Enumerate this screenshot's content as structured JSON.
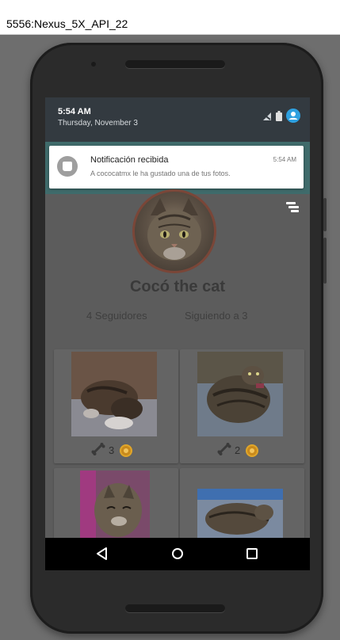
{
  "window": {
    "title": "5556:Nexus_5X_API_22"
  },
  "statusbar": {
    "time": "5:54 AM",
    "date": "Thursday, November 3"
  },
  "notification": {
    "title": "Notificación recibida",
    "text": "A cococatmx le ha gustado una de tus fotos.",
    "time": "5:54 AM"
  },
  "profile": {
    "name": "Cocó the cat",
    "followers": "4 Seguidores",
    "following": "Siguiendo a  3"
  },
  "posts": [
    {
      "likes": "3",
      "like_icon": "bone-icon",
      "coin_icon": "coin-icon"
    },
    {
      "likes": "2",
      "like_icon": "bone-icon",
      "coin_icon": "coin-icon"
    },
    {
      "likes": "",
      "like_icon": "",
      "coin_icon": ""
    },
    {
      "likes": "",
      "like_icon": "",
      "coin_icon": ""
    }
  ],
  "navbar": {
    "back_icon": "back-icon",
    "home_icon": "home-icon",
    "recents_icon": "recents-icon"
  },
  "colors": {
    "status_bar": "#333a40",
    "notification_bg": "#ffffff",
    "coin": "#c98a1c",
    "avatar_border": "#7a4638"
  }
}
